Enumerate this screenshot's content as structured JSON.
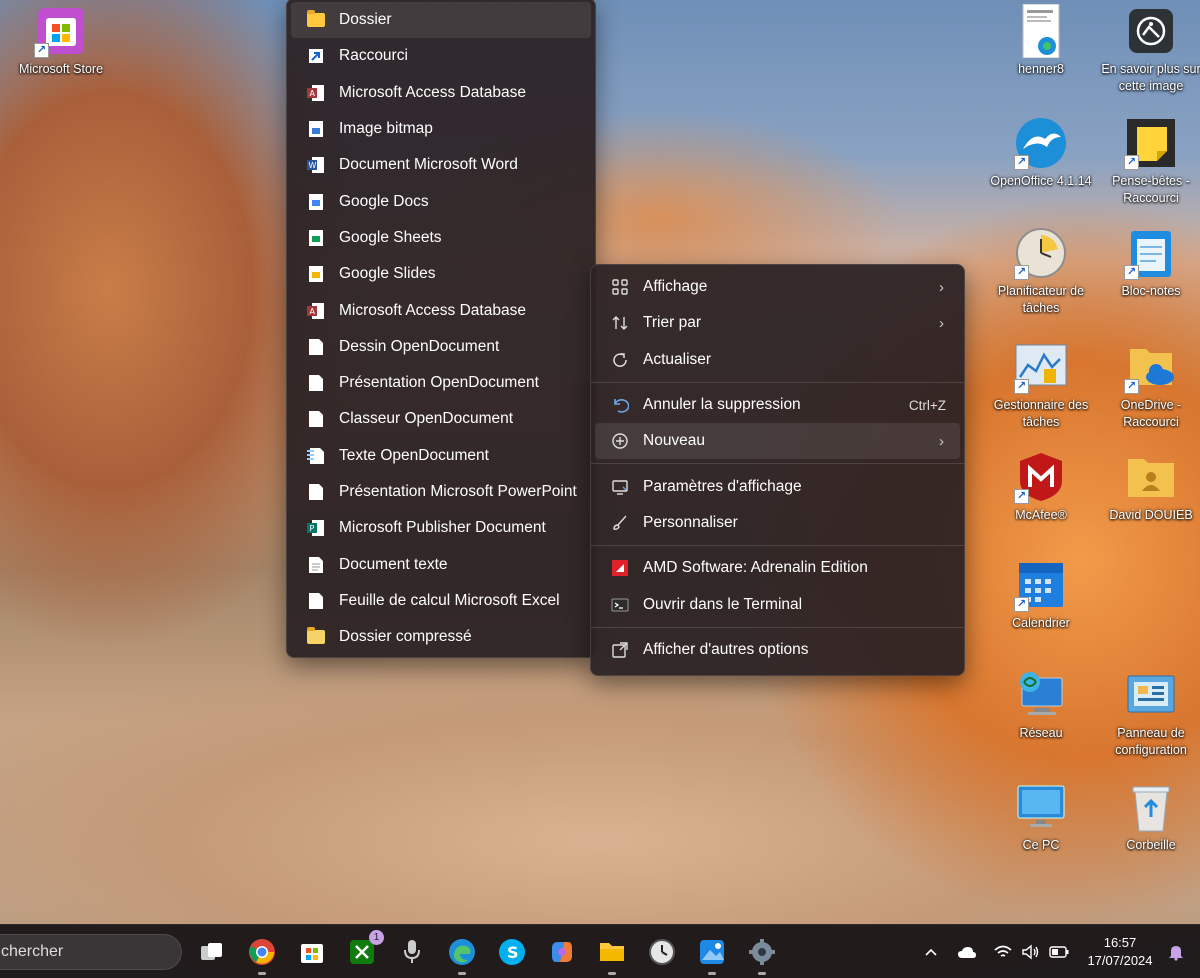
{
  "desktop_icons": [
    {
      "label": "Microsoft Store",
      "icon": "store-icon"
    },
    {
      "label": "henner8",
      "icon": "pdf-edge-icon"
    },
    {
      "label": "En savoir plus sur cette image",
      "icon": "camera-icon"
    },
    {
      "label": "OpenOffice 4.1.14",
      "icon": "openoffice-icon"
    },
    {
      "label": "Pense-bêtes - Raccourci",
      "icon": "sticky-notes-icon"
    },
    {
      "label": "Planificateur de tâches",
      "icon": "clock-icon"
    },
    {
      "label": "Bloc-notes",
      "icon": "notepad-icon"
    },
    {
      "label": "Gestionnaire des tâches",
      "icon": "task-manager-icon"
    },
    {
      "label": "OneDrive - Raccourci",
      "icon": "onedrive-icon"
    },
    {
      "label": "McAfee®",
      "icon": "mcafee-icon"
    },
    {
      "label": "David DOUIEB",
      "icon": "user-folder-icon"
    },
    {
      "label": "Calendrier",
      "icon": "calendar-icon"
    },
    {
      "label": "Réseau",
      "icon": "network-icon"
    },
    {
      "label": "Panneau de configuration",
      "icon": "control-panel-icon"
    },
    {
      "label": "Ce PC",
      "icon": "computer-icon"
    },
    {
      "label": "Corbeille",
      "icon": "recycle-bin-icon"
    }
  ],
  "new_submenu": {
    "items": [
      {
        "label": "Dossier",
        "icon": "folder-icon"
      },
      {
        "label": "Raccourci",
        "icon": "shortcut-icon"
      },
      {
        "label": "Microsoft Access Database",
        "icon": "access-icon"
      },
      {
        "label": "Image bitmap",
        "icon": "bitmap-icon"
      },
      {
        "label": "Document Microsoft Word",
        "icon": "word-icon"
      },
      {
        "label": "Google Docs",
        "icon": "google-docs-icon"
      },
      {
        "label": "Google Sheets",
        "icon": "google-sheets-icon"
      },
      {
        "label": "Google Slides",
        "icon": "google-slides-icon"
      },
      {
        "label": "Microsoft Access Database",
        "icon": "access-icon"
      },
      {
        "label": "Dessin OpenDocument",
        "icon": "document-icon"
      },
      {
        "label": "Présentation OpenDocument",
        "icon": "document-icon"
      },
      {
        "label": "Classeur OpenDocument",
        "icon": "document-icon"
      },
      {
        "label": "Texte OpenDocument",
        "icon": "text-document-icon"
      },
      {
        "label": "Présentation Microsoft PowerPoint",
        "icon": "document-icon"
      },
      {
        "label": "Microsoft Publisher Document",
        "icon": "publisher-icon"
      },
      {
        "label": "Document texte",
        "icon": "text-file-icon"
      },
      {
        "label": "Feuille de calcul Microsoft Excel",
        "icon": "document-icon"
      },
      {
        "label": "Dossier compressé",
        "icon": "zip-folder-icon"
      }
    ]
  },
  "context_menu": {
    "view": "Affichage",
    "sort": "Trier par",
    "refresh": "Actualiser",
    "undo": "Annuler la suppression",
    "undo_shortcut": "Ctrl+Z",
    "new": "Nouveau",
    "display_settings": "Paramètres d'affichage",
    "personalize": "Personnaliser",
    "amd": "AMD Software: Adrenalin Edition",
    "terminal": "Ouvrir dans le Terminal",
    "more_options": "Afficher d'autres options"
  },
  "taskbar": {
    "search_text": "chercher",
    "xbox_badge": "1",
    "time": "16:57",
    "date": "17/07/2024"
  },
  "colors": {
    "menu_bg": "#2c2224",
    "accent_blue": "#0078d4",
    "amd_red": "#e0202a"
  }
}
